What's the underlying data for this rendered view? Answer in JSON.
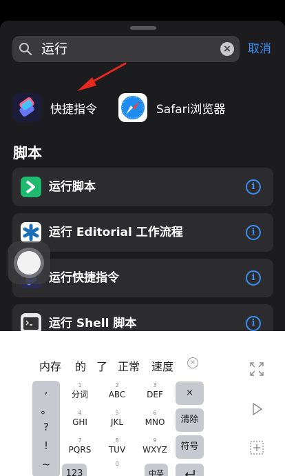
{
  "search": {
    "query": "运行",
    "cancel_label": "取消"
  },
  "apps": [
    {
      "label": "快捷指令",
      "icon": "shortcuts-app-icon"
    },
    {
      "label": "Safari浏览器",
      "icon": "safari-app-icon"
    }
  ],
  "section_title": "脚本",
  "actions": [
    {
      "label": "运行脚本",
      "icon": "scriptable-icon"
    },
    {
      "label": "运行 Editorial 工作流程",
      "icon": "editorial-icon"
    },
    {
      "label": "运行快捷指令",
      "icon": "shortcuts-icon"
    },
    {
      "label": "运行 Shell 脚本",
      "icon": "terminal-icon"
    }
  ],
  "keyboard": {
    "candidates": [
      "内存",
      "的",
      "了",
      "正常",
      "速度"
    ],
    "punctuation": [
      ",",
      "。",
      "?",
      "!",
      "~"
    ],
    "keys": [
      {
        "num": "1",
        "label": "分词"
      },
      {
        "num": "2",
        "label": "ABC"
      },
      {
        "num": "3",
        "label": "DEF"
      },
      {
        "num": "4",
        "label": "GHI"
      },
      {
        "num": "5",
        "label": "JKL"
      },
      {
        "num": "6",
        "label": "MNO"
      },
      {
        "num": "7",
        "label": "PQRS"
      },
      {
        "num": "8",
        "label": "TUV"
      },
      {
        "num": "9",
        "label": "WXYZ"
      }
    ],
    "function_keys": [
      "×",
      "清除",
      "符号"
    ],
    "bottom": {
      "numbers": "123",
      "zero": "0",
      "lang": "中英"
    }
  },
  "colors": {
    "accent": "#3b8ff6",
    "sheet": "#1c1c1e",
    "row": "#2c2c2e",
    "arrow": "#e8281e"
  }
}
